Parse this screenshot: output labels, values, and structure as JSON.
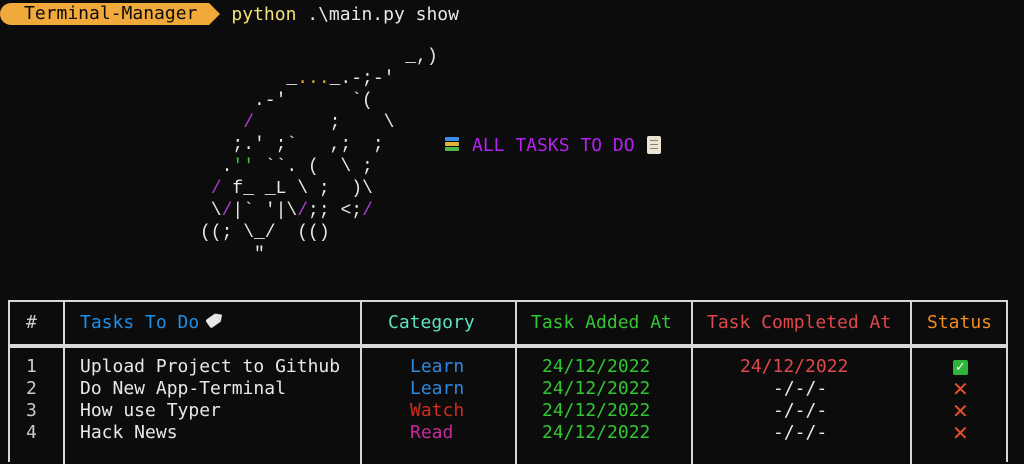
{
  "prompt": {
    "badge_label": "Terminal-Manager",
    "command_exe": "python",
    "command_args": " .\\main.py show"
  },
  "banner": {
    "left_icon": "books-icon",
    "title": "ALL TASKS TO DO",
    "right_icon": "scroll-icon"
  },
  "colors": {
    "badge": "#f2a93b",
    "banner": "#b620f2",
    "header_index": "#cccccc",
    "header_tasks": "#1f8fe8",
    "header_category": "#5fe0c0",
    "header_added": "#33c633",
    "header_completed": "#e0484c",
    "header_status": "#f28c1a",
    "category_learn": "#2e88e0",
    "category_watch": "#d42a1c",
    "category_read": "#c42a9c",
    "date_added": "#33c633",
    "date_completed": "#e0484c"
  },
  "table": {
    "headers": {
      "index": "#",
      "tasks": "Tasks To Do",
      "category": "Category",
      "added": "Task Added At",
      "completed": "Task Completed At",
      "status": "Status"
    },
    "rows": [
      {
        "index": "1",
        "task": "Upload Project to Github",
        "category": "Learn",
        "added": "24/12/2022",
        "completed": "24/12/2022",
        "status": "done",
        "status_icon": "check-icon"
      },
      {
        "index": "2",
        "task": "Do New App-Terminal",
        "category": "Learn",
        "added": "24/12/2022",
        "completed": "-/-/-",
        "status": "not-done",
        "status_icon": "cross-icon"
      },
      {
        "index": "3",
        "task": "How use Typer",
        "category": "Watch",
        "added": "24/12/2022",
        "completed": "-/-/-",
        "status": "not-done",
        "status_icon": "cross-icon"
      },
      {
        "index": "4",
        "task": "Hack News",
        "category": "Read",
        "added": "24/12/2022",
        "completed": "-/-/-",
        "status": "not-done",
        "status_icon": "cross-icon"
      }
    ]
  }
}
